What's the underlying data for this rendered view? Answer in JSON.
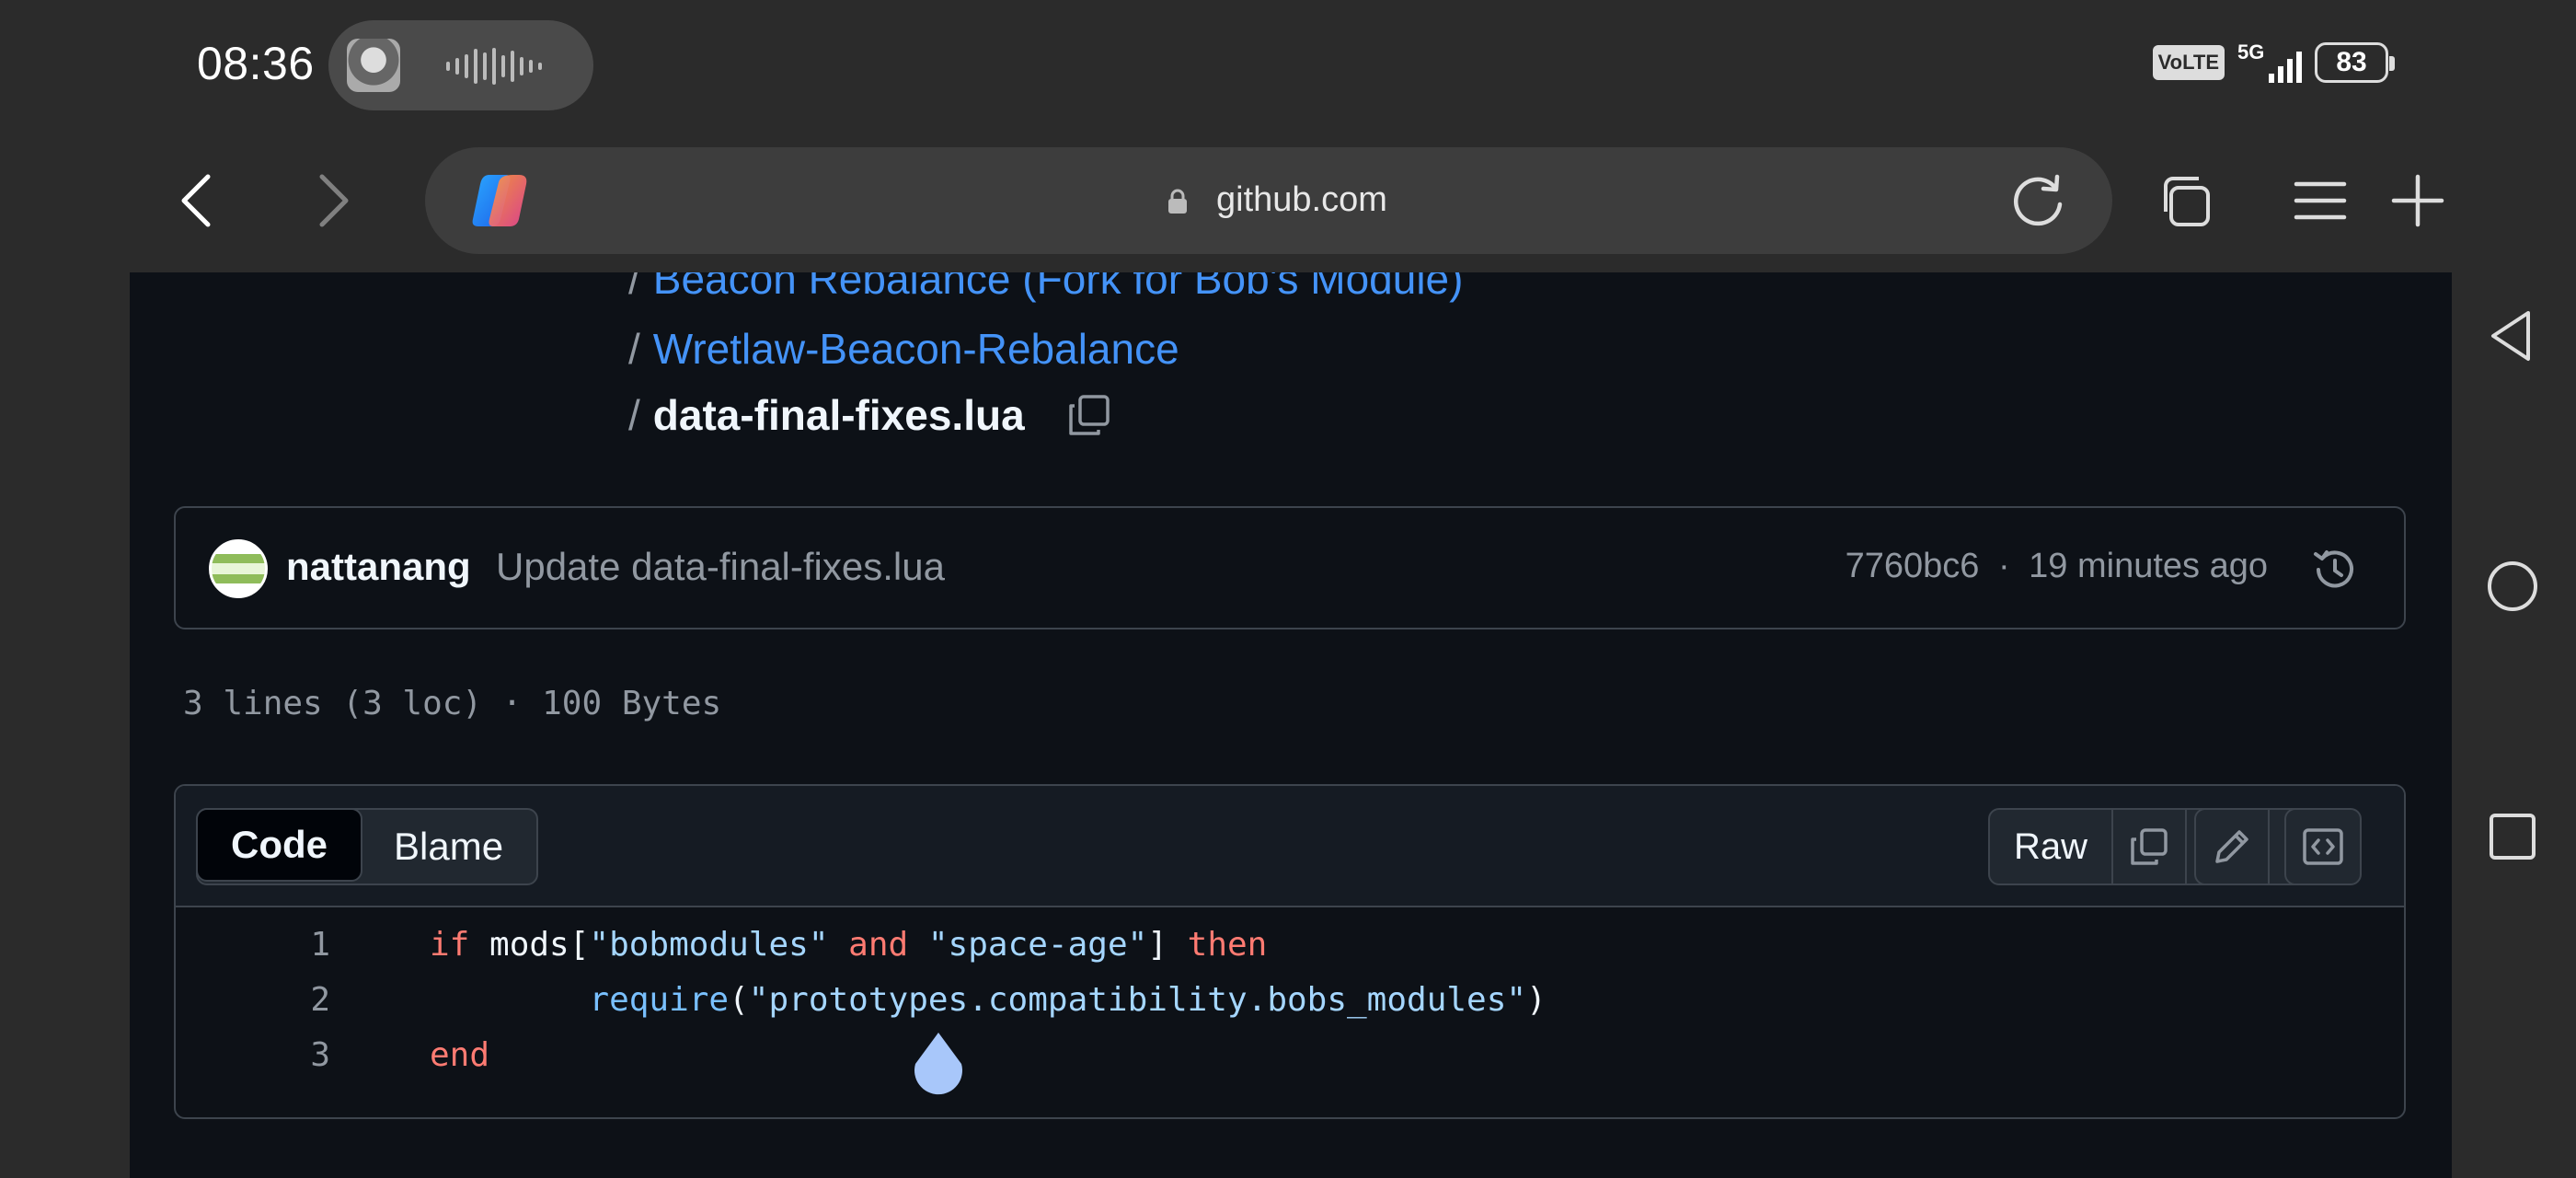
{
  "status_bar": {
    "time": "08:36",
    "volte": "VoLTE",
    "network": "5G",
    "battery": "83"
  },
  "browser": {
    "url": "github.com"
  },
  "breadcrumb": {
    "items": [
      "Beacon Rebalance (Fork for Bob's Module)",
      "Wretlaw-Beacon-Rebalance"
    ],
    "separator": "/",
    "current_file": "data-final-fixes.lua"
  },
  "commit": {
    "author": "nattanang",
    "message": "Update data-final-fixes.lua",
    "sha": "7760bc6",
    "dot": "·",
    "time_ago": "19 minutes ago"
  },
  "file_info": "3 lines (3 loc) · 100 Bytes",
  "viewer": {
    "tabs": [
      "Code",
      "Blame"
    ],
    "active_tab": "Code",
    "raw_label": "Raw"
  },
  "code": {
    "line_numbers": [
      "1",
      "2",
      "3"
    ],
    "line1": {
      "kw_if": "if",
      "ident": " mods[",
      "str1": "\"bobmodules\"",
      "and": " and ",
      "str2": "\"space-age\"",
      "close": "] ",
      "kw_then": "then"
    },
    "line2": {
      "indent": "        ",
      "fn": "require",
      "open": "(",
      "str": "\"prototypes.compatibility.bobs_modules\"",
      "close": ")"
    },
    "line3": {
      "kw_end": "end"
    }
  },
  "colors": {
    "accent_link": "#4493f8",
    "keyword": "#ff7b72",
    "string": "#a5d6ff",
    "page_bg": "#0d1117"
  }
}
